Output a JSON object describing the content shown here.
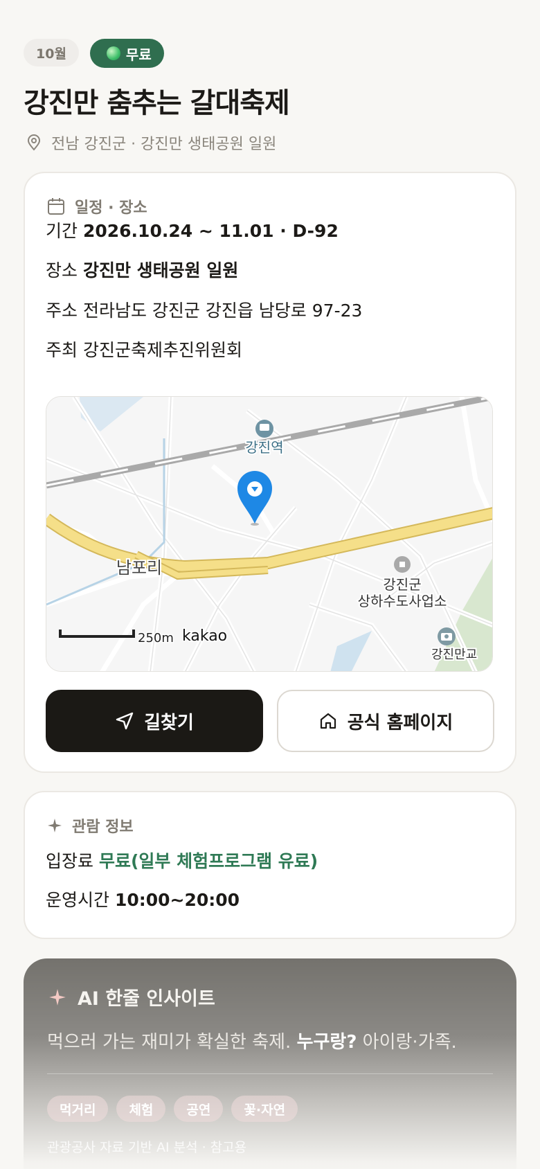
{
  "header": {
    "month_tag": "10월",
    "free_tag": "무료",
    "title": "강진만 춤추는 갈대축제",
    "location": "전남 강진군 · 강진만 생태공원 일원"
  },
  "schedule": {
    "heading": "일정 · 장소",
    "period_label": "기간",
    "period_value": "2026.10.24 ~ 11.01 · D-92",
    "place_label": "장소",
    "place_value": "강진만 생태공원 일원",
    "address_label": "주소",
    "address_value": "전라남도 강진군 강진읍 남당로 97-23",
    "host_label": "주최",
    "host_value": "강진군축제추진위원회"
  },
  "map": {
    "station_label": "강진역",
    "area_label": "남포리",
    "office_label_1": "강진군",
    "office_label_2": "상하수도사업소",
    "cut_label": "강진만교",
    "scale_label": "250m",
    "provider": "kakao"
  },
  "buttons": {
    "directions": "길찾기",
    "homepage": "공식 홈페이지"
  },
  "visit": {
    "heading": "관람 정보",
    "fee_label": "입장료",
    "fee_value": "무료(일부 체험프로그램 유료)",
    "hours_label": "운영시간",
    "hours_value": "10:00~20:00"
  },
  "ai": {
    "heading": "AI 한줄 인사이트",
    "text_main": "먹으러 가는 재미가 확실한 축제.",
    "text_bold": "누구랑?",
    "text_tail": "아이랑·가족.",
    "tags": [
      "먹거리",
      "체험",
      "공연",
      "꽃·자연"
    ],
    "footnote": "관광공사 자료 기반 AI 분석 · 참고용"
  },
  "colors": {
    "accent_green": "#2f6e4f",
    "pin_blue": "#1e88e5",
    "dark_button": "#1b1915"
  }
}
